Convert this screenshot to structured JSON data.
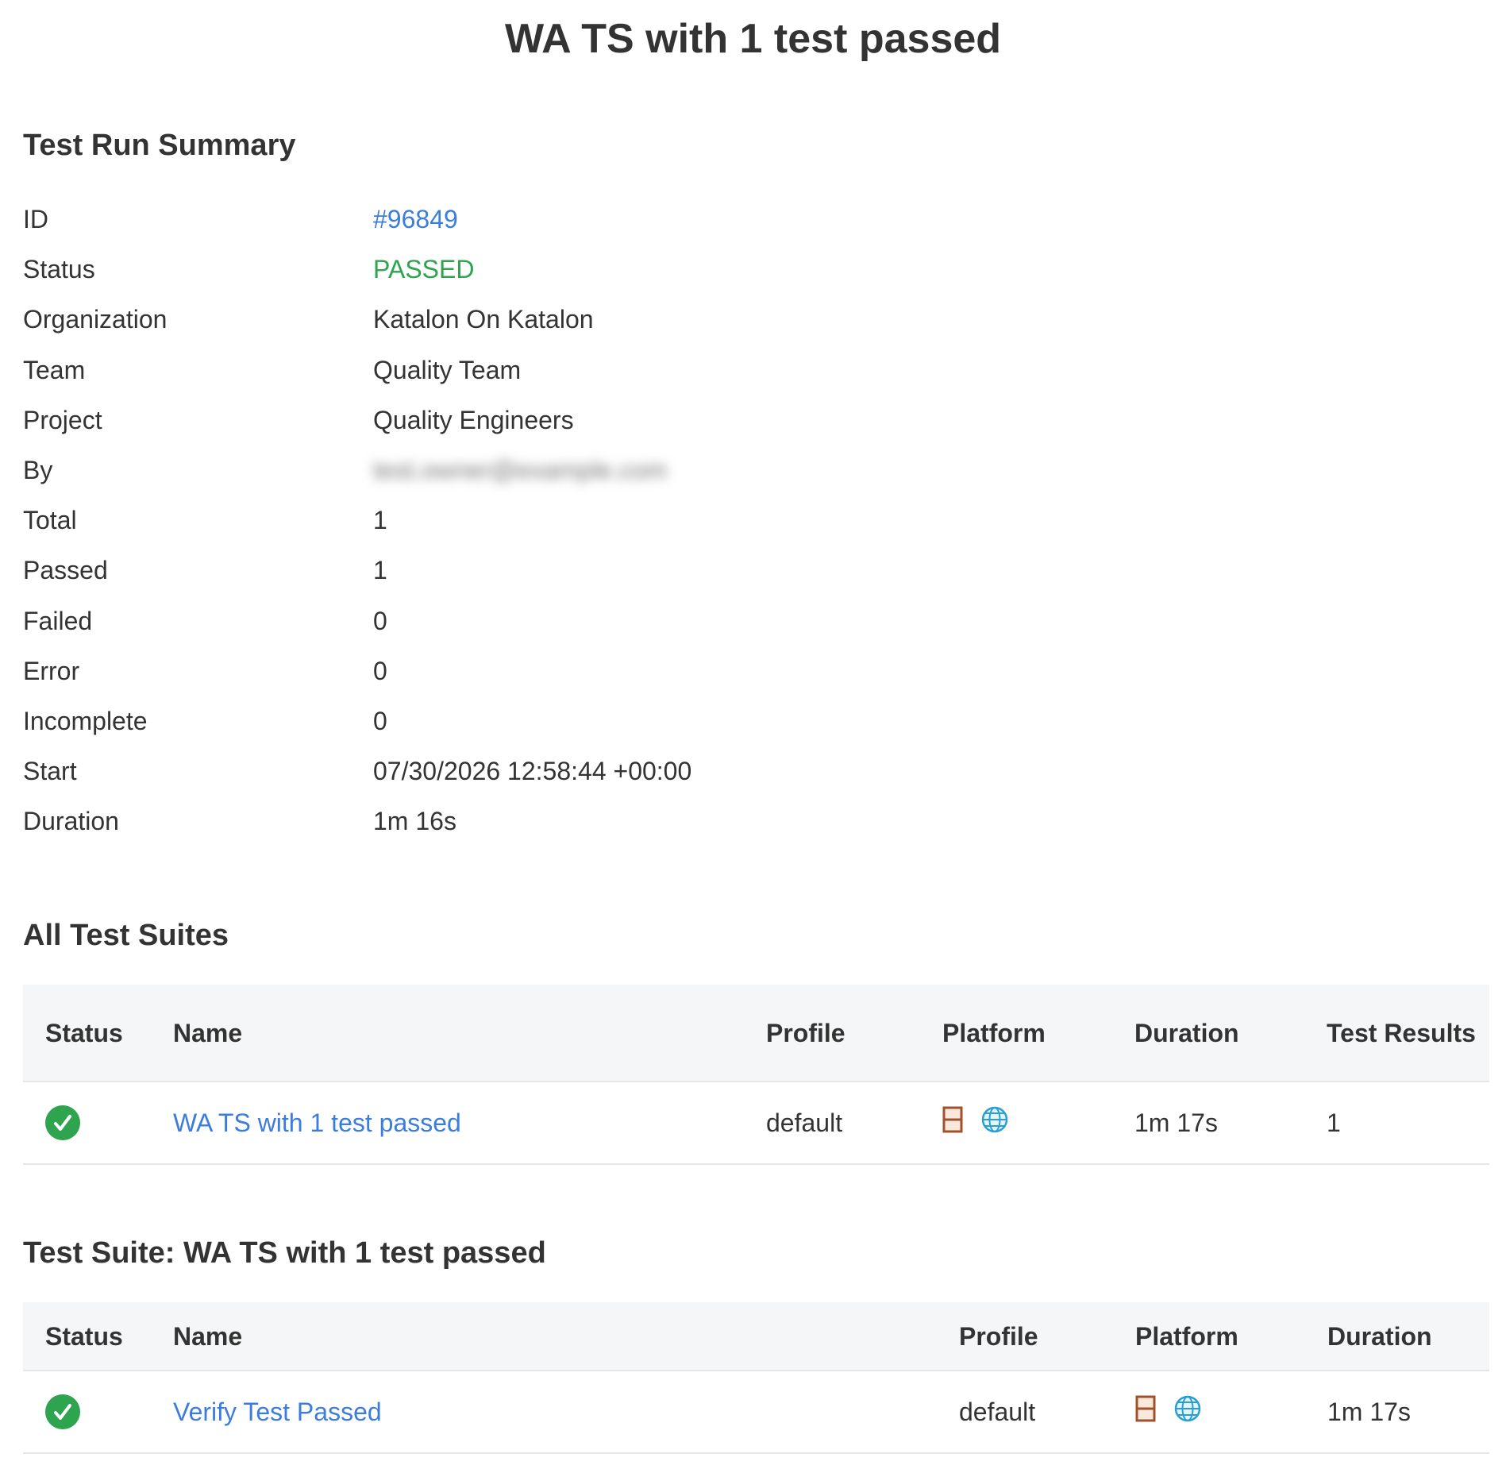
{
  "page_title": "WA TS with 1 test passed",
  "summary": {
    "heading": "Test Run Summary",
    "rows": [
      {
        "label": "ID",
        "value": "#96849",
        "style": "link"
      },
      {
        "label": "Status",
        "value": "PASSED",
        "style": "passed"
      },
      {
        "label": "Organization",
        "value": "Katalon On Katalon",
        "style": ""
      },
      {
        "label": "Team",
        "value": "Quality Team",
        "style": ""
      },
      {
        "label": "Project",
        "value": "Quality Engineers",
        "style": ""
      },
      {
        "label": "By",
        "value": "test.owner@example.com",
        "style": "blurred"
      },
      {
        "label": "Total",
        "value": "1",
        "style": ""
      },
      {
        "label": "Passed",
        "value": "1",
        "style": ""
      },
      {
        "label": "Failed",
        "value": "0",
        "style": ""
      },
      {
        "label": "Error",
        "value": "0",
        "style": ""
      },
      {
        "label": "Incomplete",
        "value": "0",
        "style": ""
      },
      {
        "label": "Start",
        "value": "07/30/2026 12:58:44 +00:00",
        "style": ""
      },
      {
        "label": "Duration",
        "value": "1m 16s",
        "style": ""
      }
    ]
  },
  "suites": {
    "heading": "All Test Suites",
    "columns": {
      "status": "Status",
      "name": "Name",
      "profile": "Profile",
      "platform": "Platform",
      "duration": "Duration",
      "test_results": "Test Results"
    },
    "rows": [
      {
        "status": "passed",
        "status_icon": "check-circle-icon",
        "name": "WA TS with 1 test passed",
        "profile": "default",
        "platform_icons": [
          "window-icon",
          "globe-icon"
        ],
        "duration": "1m 17s",
        "test_results": "1"
      }
    ]
  },
  "suite_detail": {
    "heading": "Test Suite: WA TS with 1 test passed",
    "columns": {
      "status": "Status",
      "name": "Name",
      "profile": "Profile",
      "platform": "Platform",
      "duration": "Duration"
    },
    "rows": [
      {
        "status": "passed",
        "status_icon": "check-circle-icon",
        "name": "Verify Test Passed",
        "profile": "default",
        "platform_icons": [
          "window-icon",
          "globe-icon"
        ],
        "duration": "1m 17s"
      }
    ]
  },
  "colors": {
    "link": "#3b7ddd",
    "passed": "#2ea44f",
    "header_bg": "#f5f6f7",
    "text": "#333333"
  }
}
